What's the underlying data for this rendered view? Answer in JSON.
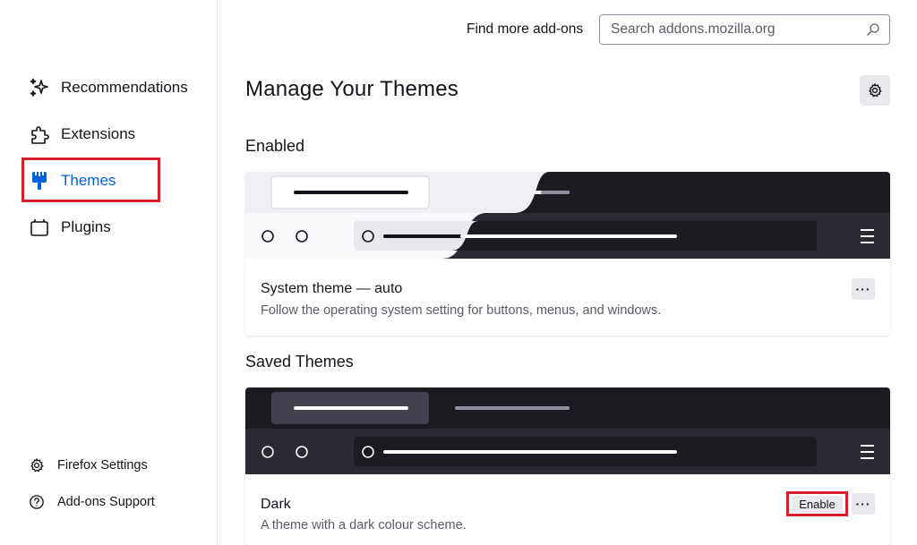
{
  "sidebar": {
    "items": [
      {
        "label": "Recommendations",
        "icon": "sparkle-icon"
      },
      {
        "label": "Extensions",
        "icon": "puzzle-icon"
      },
      {
        "label": "Themes",
        "icon": "paintbrush-icon"
      },
      {
        "label": "Plugins",
        "icon": "plugin-icon"
      }
    ],
    "footer": [
      {
        "label": "Firefox Settings",
        "icon": "gear-icon"
      },
      {
        "label": "Add-ons Support",
        "icon": "help-icon"
      }
    ]
  },
  "header": {
    "find_label": "Find more add-ons",
    "search_placeholder": "Search addons.mozilla.org"
  },
  "main": {
    "title": "Manage Your Themes",
    "enabled_heading": "Enabled",
    "saved_heading": "Saved Themes",
    "enabled_theme": {
      "name": "System theme — auto",
      "description": "Follow the operating system setting for buttons, menus, and windows."
    },
    "saved_themes": [
      {
        "name": "Dark",
        "description": "A theme with a dark colour scheme.",
        "enable_label": "Enable"
      }
    ]
  },
  "colors": {
    "accent": "#0061e0",
    "highlight_border": "#d61f2b",
    "dark_preview": "#1c1b22",
    "dark_toolbar": "#2b2a33",
    "light_preview": "#f0f0f4"
  }
}
